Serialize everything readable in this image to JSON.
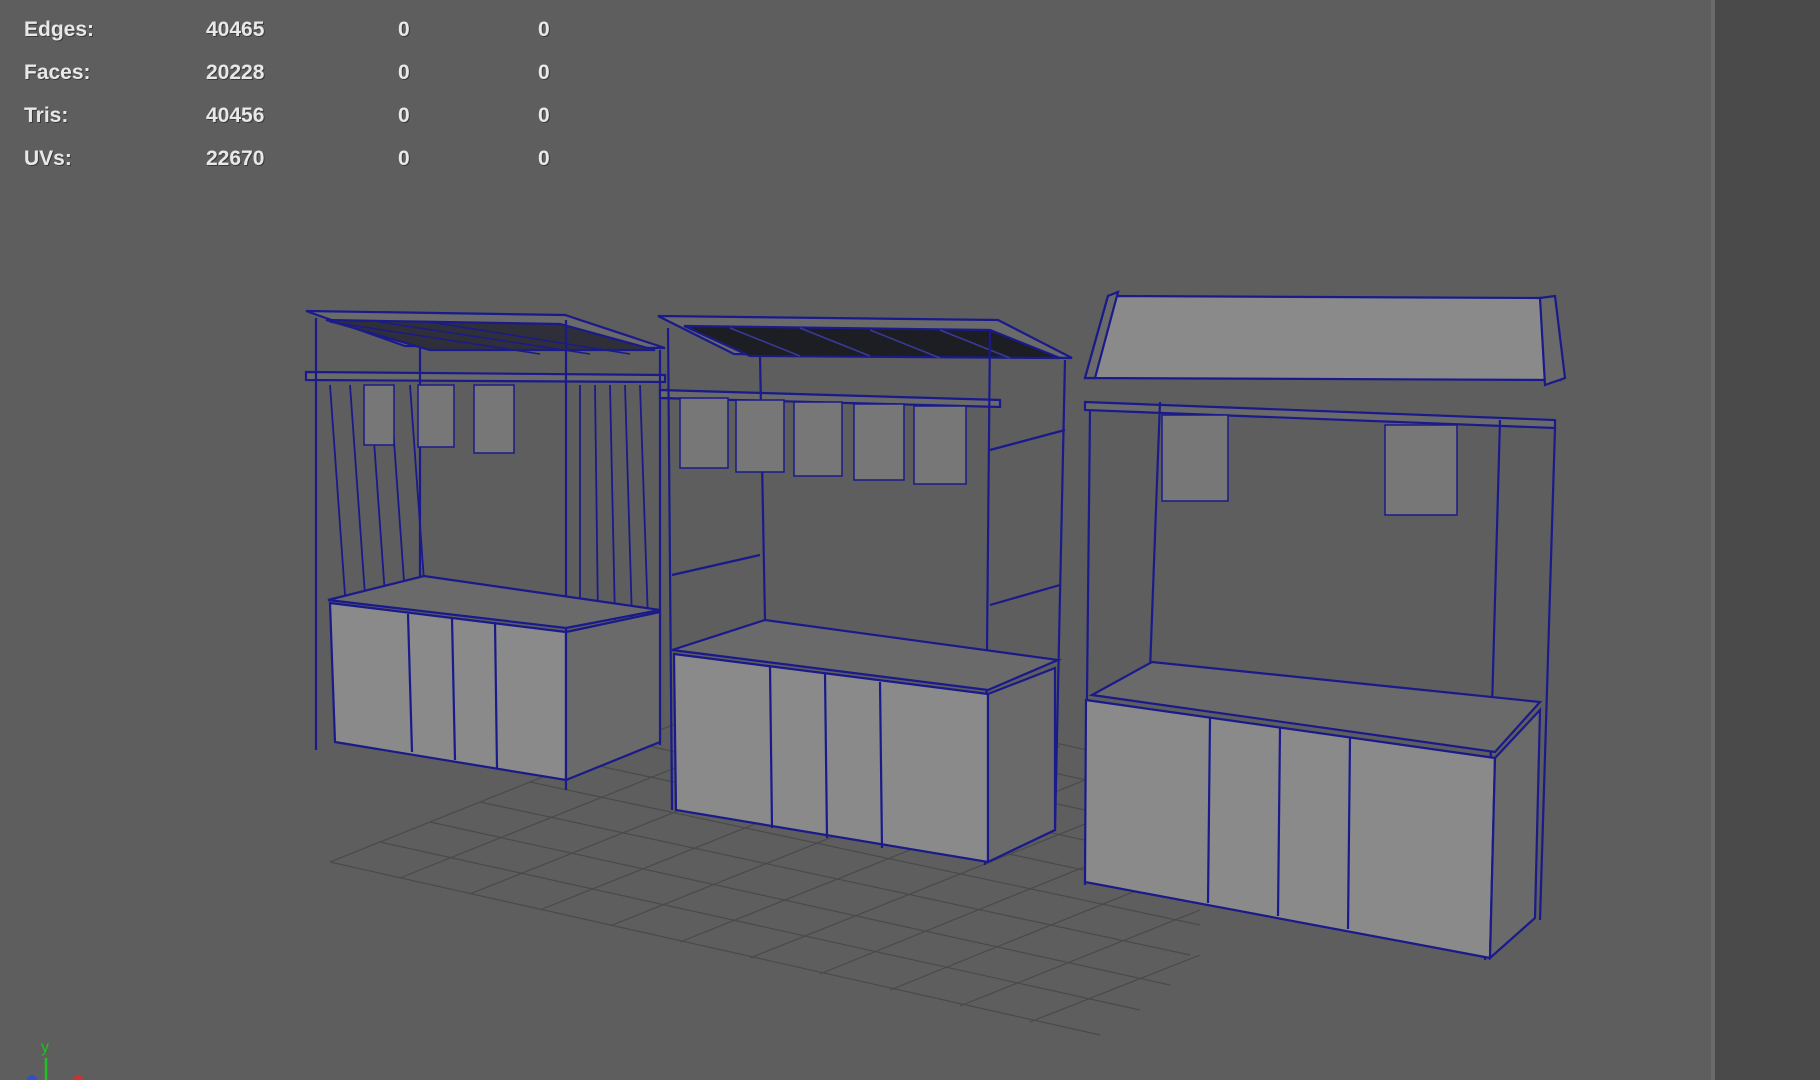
{
  "hud": {
    "rows": [
      {
        "label": "Edges:",
        "v1": "40465",
        "v2": "0",
        "v3": "0"
      },
      {
        "label": "Faces:",
        "v1": "20228",
        "v2": "0",
        "v3": "0"
      },
      {
        "label": "Tris:",
        "v1": "40456",
        "v2": "0",
        "v3": "0"
      },
      {
        "label": "UVs:",
        "v1": "22670",
        "v2": "0",
        "v3": "0"
      }
    ]
  },
  "axis": {
    "y_label": "y"
  },
  "colors": {
    "viewport_bg": "#5e5e5e",
    "wire": "#1a1a8a",
    "face_light": "#8a8a8a",
    "face_dark": "#6a6a6a",
    "grid": "#4a4a4a",
    "axis_y": "#22c022",
    "axis_x": "#d03030",
    "axis_z": "#3050d0"
  }
}
